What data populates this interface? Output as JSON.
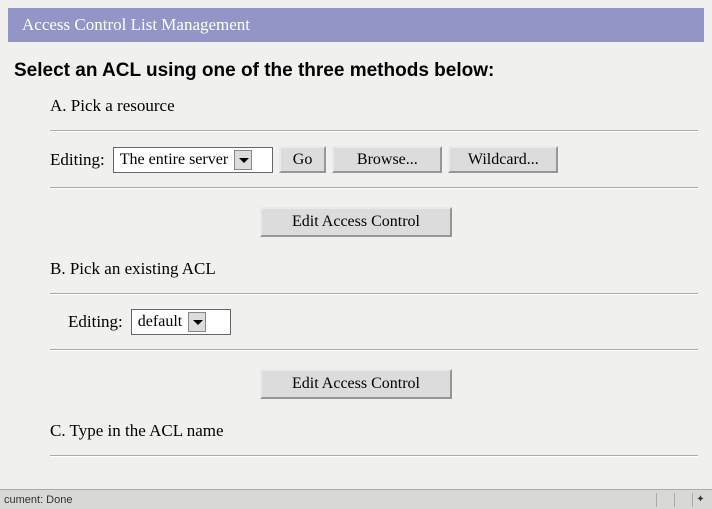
{
  "titleBar": "Access Control List Management",
  "instruction": "Select an ACL using one of the three methods below:",
  "sectionA": {
    "label": "A. Pick a resource",
    "editingLabel": "Editing:",
    "selectValue": "The entire server",
    "goBtn": "Go",
    "browseBtn": "Browse...",
    "wildcardBtn": "Wildcard...",
    "editBtn": "Edit Access Control"
  },
  "sectionB": {
    "label": "B. Pick an existing ACL",
    "editingLabel": "Editing:",
    "selectValue": "default",
    "editBtn": "Edit Access Control"
  },
  "sectionC": {
    "label": "C. Type in the ACL name"
  },
  "statusBar": {
    "text": "cument: Done"
  }
}
